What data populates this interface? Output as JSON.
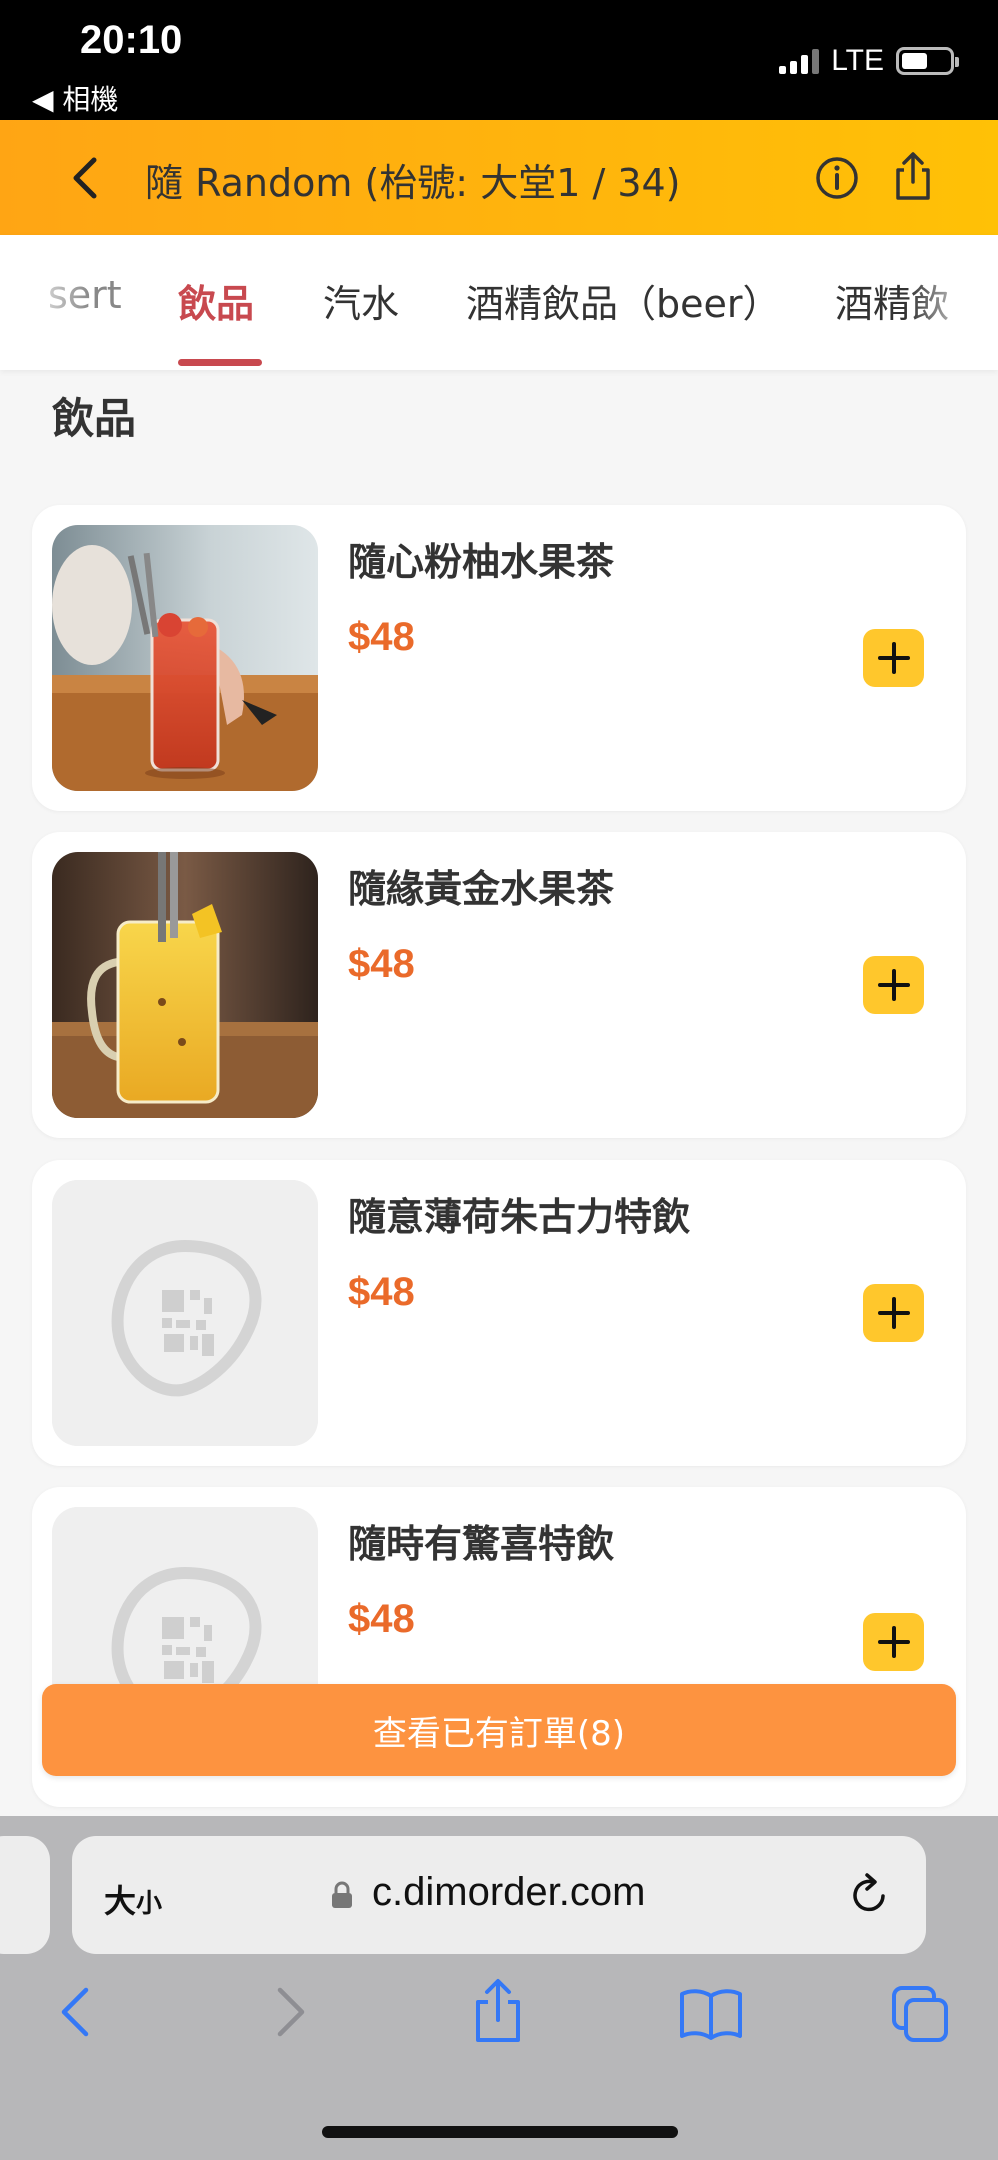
{
  "status_bar": {
    "time": "20:10",
    "back_app": "◀ 相機",
    "network": "LTE",
    "battery_level": 0.55
  },
  "header": {
    "title": "隨 Random (枱號: 大堂1 / 34)",
    "back_icon": "chevron-left-icon",
    "info_icon": "info-icon",
    "share_icon": "share-icon"
  },
  "tabs": [
    {
      "label": "sert",
      "active": false
    },
    {
      "label": "飲品",
      "active": true
    },
    {
      "label": "汽水",
      "active": false
    },
    {
      "label": "酒精飲品（beer）",
      "active": false
    },
    {
      "label": "酒精飲",
      "active": false
    }
  ],
  "section": {
    "title": "飲品"
  },
  "items": [
    {
      "name": "隨心粉柚水果茶",
      "price": "$48",
      "image": "red-fruit-tea-photo"
    },
    {
      "name": "隨緣黃金水果茶",
      "price": "$48",
      "image": "yellow-fruit-tea-photo"
    },
    {
      "name": "隨意薄荷朱古力特飲",
      "price": "$48",
      "image": "placeholder-logo"
    },
    {
      "name": "隨時有驚喜特飲",
      "price": "$48",
      "image": "placeholder-logo"
    }
  ],
  "order_bar": {
    "label": "查看已有訂單(8)"
  },
  "safari": {
    "text_size_label": "大",
    "text_size_small": "小",
    "url": "c.dimorder.com"
  },
  "colors": {
    "header_start": "#ffa514",
    "header_end": "#ffc106",
    "active_tab": "#c8494f",
    "price": "#ea6a2a",
    "add_button": "#ffc72c",
    "order_bar": "#fd9340",
    "safari_blue": "#3478f6"
  }
}
